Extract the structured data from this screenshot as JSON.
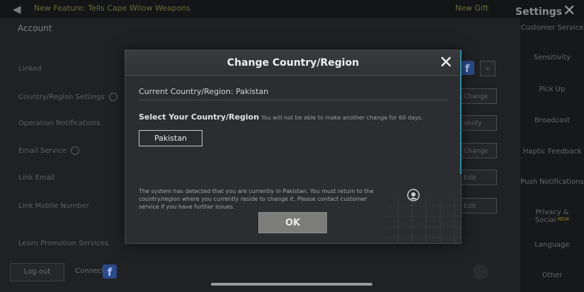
{
  "background": {
    "topbar": {
      "marquee": "New Feature: Tells Cape Wilow Weapons",
      "promo": "New Gift",
      "settings_title": "Settings"
    },
    "account_heading": "Account",
    "list_items": [
      "Linked",
      "Country/Region Settings",
      "Operation Notifications",
      "Email Service",
      "Link Email",
      "Link Mobile Number",
      "Learn Promotion Services"
    ],
    "right_buttons": [
      "Change",
      "Verify",
      "Change",
      "Edit",
      "Edit"
    ],
    "side_menu": [
      "Customer Service",
      "Sensitivity",
      "Pick Up",
      "Broadcast",
      "Haptic Feedback",
      "Push Notifications",
      "Privacy & Social",
      "Language",
      "Other"
    ],
    "side_new_badge": "NEW",
    "logout_label": "Log out",
    "connect_label": "Connect"
  },
  "dialog": {
    "title": "Change Country/Region",
    "current_region": "Current Country/Region: Pakistan",
    "select_label": "Select Your Country/Region",
    "select_note": "You will not be able to make another change for 60 days.",
    "selected_country": "Pakistan",
    "notice": "The system has detected that you are currently in Pakistan. You must return to the country/region where you currently reside to change it. Please contact customer service if you have further issues.",
    "ok_label": "OK"
  },
  "colors": {
    "dialog_bg": "#2c2d30",
    "ok_button": "#7c7c7a",
    "accent_edge": "#2f8fa0",
    "facebook": "#2a4a8a"
  }
}
